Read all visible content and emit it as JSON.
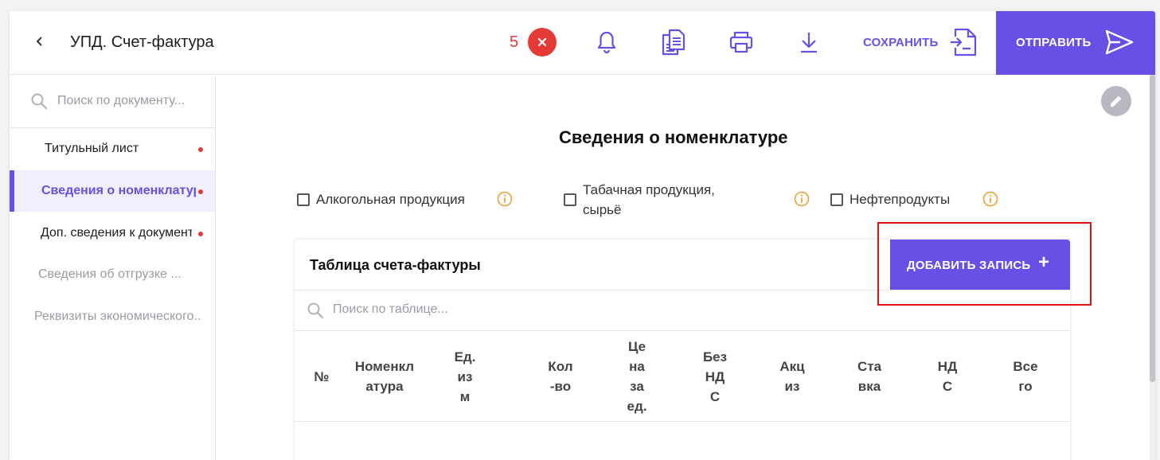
{
  "header": {
    "title": "УПД. Счет-фактура",
    "error_count": "5",
    "save_label": "СОХРАНИТЬ",
    "send_label": "ОТПРАВИТЬ"
  },
  "sidebar": {
    "search_placeholder": "Поиск по документу...",
    "items": [
      {
        "label": "Титульный лист",
        "has_error": true,
        "active": false
      },
      {
        "label": "Сведения о номенклатуре",
        "has_error": true,
        "active": true
      },
      {
        "label": "Доп. сведения к документу",
        "has_error": true,
        "active": false
      },
      {
        "label": "Сведения об отгрузке ...",
        "has_error": false,
        "active": false
      },
      {
        "label": "Реквизиты экономического...",
        "has_error": false,
        "active": false
      }
    ]
  },
  "main": {
    "section_title": "Сведения о номенклатуре",
    "checkboxes": [
      {
        "label": "Алкогольная продукция",
        "checked": false
      },
      {
        "label": "Табачная продукция, сырьё",
        "checked": false
      },
      {
        "label": "Нефтепродукты",
        "checked": false
      }
    ],
    "table": {
      "title": "Таблица счета-фактуры",
      "add_label": "ДОБАВИТЬ ЗАПИСЬ",
      "add_icon": "+",
      "search_placeholder": "Поиск по таблице...",
      "columns": [
        [
          "№"
        ],
        [
          "Номенкл",
          "атура"
        ],
        [
          "Ед.",
          "из",
          "м"
        ],
        [
          "Кол",
          "-во"
        ],
        [
          "Це",
          "на",
          "за",
          "ед."
        ],
        [
          "Без",
          "НД",
          "С"
        ],
        [
          "Акц",
          "из"
        ],
        [
          "Ста",
          "вка"
        ],
        [
          "НД",
          "С"
        ],
        [
          "Все",
          "го"
        ]
      ]
    }
  },
  "colors": {
    "accent": "#6a4fe6",
    "error": "#e53935",
    "info": "#f0a030",
    "highlight": "#e01010"
  }
}
